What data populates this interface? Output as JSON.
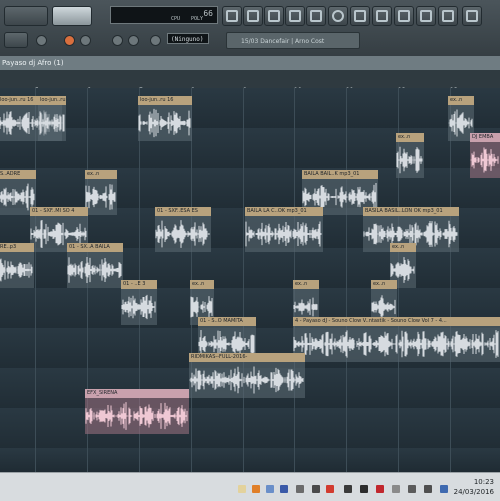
{
  "toolbar": {
    "counter": "66",
    "counter_labels": [
      "CPU",
      "POLY"
    ],
    "pattern_label": "(Ninguno)",
    "song_line": "15/03 Dancefair | Arno Cost"
  },
  "window": {
    "title": "Payaso dj Afro (1)"
  },
  "ruler": {
    "bars": [
      "5",
      "6",
      "7",
      "8",
      "9",
      "10",
      "11",
      "12",
      "13"
    ]
  },
  "clips": [
    {
      "label": "loo-jun..ru 16"
    },
    {
      "label": "loo-jun..ru 16"
    },
    {
      "label": "loo-jun..ru 16"
    },
    {
      "label": "ex..n"
    },
    {
      "label": "ex..n"
    },
    {
      "label": "DJ EMBA"
    },
    {
      "label": "S..ADRE"
    },
    {
      "label": "ex..n"
    },
    {
      "label": "BAILA BAIL..K mp3_01"
    },
    {
      "label": "01 - SXF..MI SO 4"
    },
    {
      "label": "01 - SXF..ESA ES"
    },
    {
      "label": "BAILA LA C..OK mp3_01"
    },
    {
      "label": "BASILA BASIL..LON OK mp3_01"
    },
    {
      "label": "RE..p3"
    },
    {
      "label": "01 - SX..A BAILA"
    },
    {
      "label": "ex..n"
    },
    {
      "label": "01 - ..E 3"
    },
    {
      "label": "ex..n"
    },
    {
      "label": "ex..n"
    },
    {
      "label": "ex..n"
    },
    {
      "label": "01 - S..O MAMITA"
    },
    {
      "label": "4 - Payaso dJ - Souno Clow V..ntastik - Souno Clow Vol 7 - 4..."
    },
    {
      "label": "RIDMIKAS--FULL-2016-"
    },
    {
      "label": "EFX_SIRENA"
    }
  ],
  "taskbar": {
    "time": "10:23",
    "date": "24/03/2016"
  },
  "colors": {
    "clip_header": "#b8a27d",
    "clip_header_pink": "#c9a1ad",
    "waveform": "#d6dbe0",
    "waveform_pink": "#efc8d4",
    "background": "#24313a"
  }
}
